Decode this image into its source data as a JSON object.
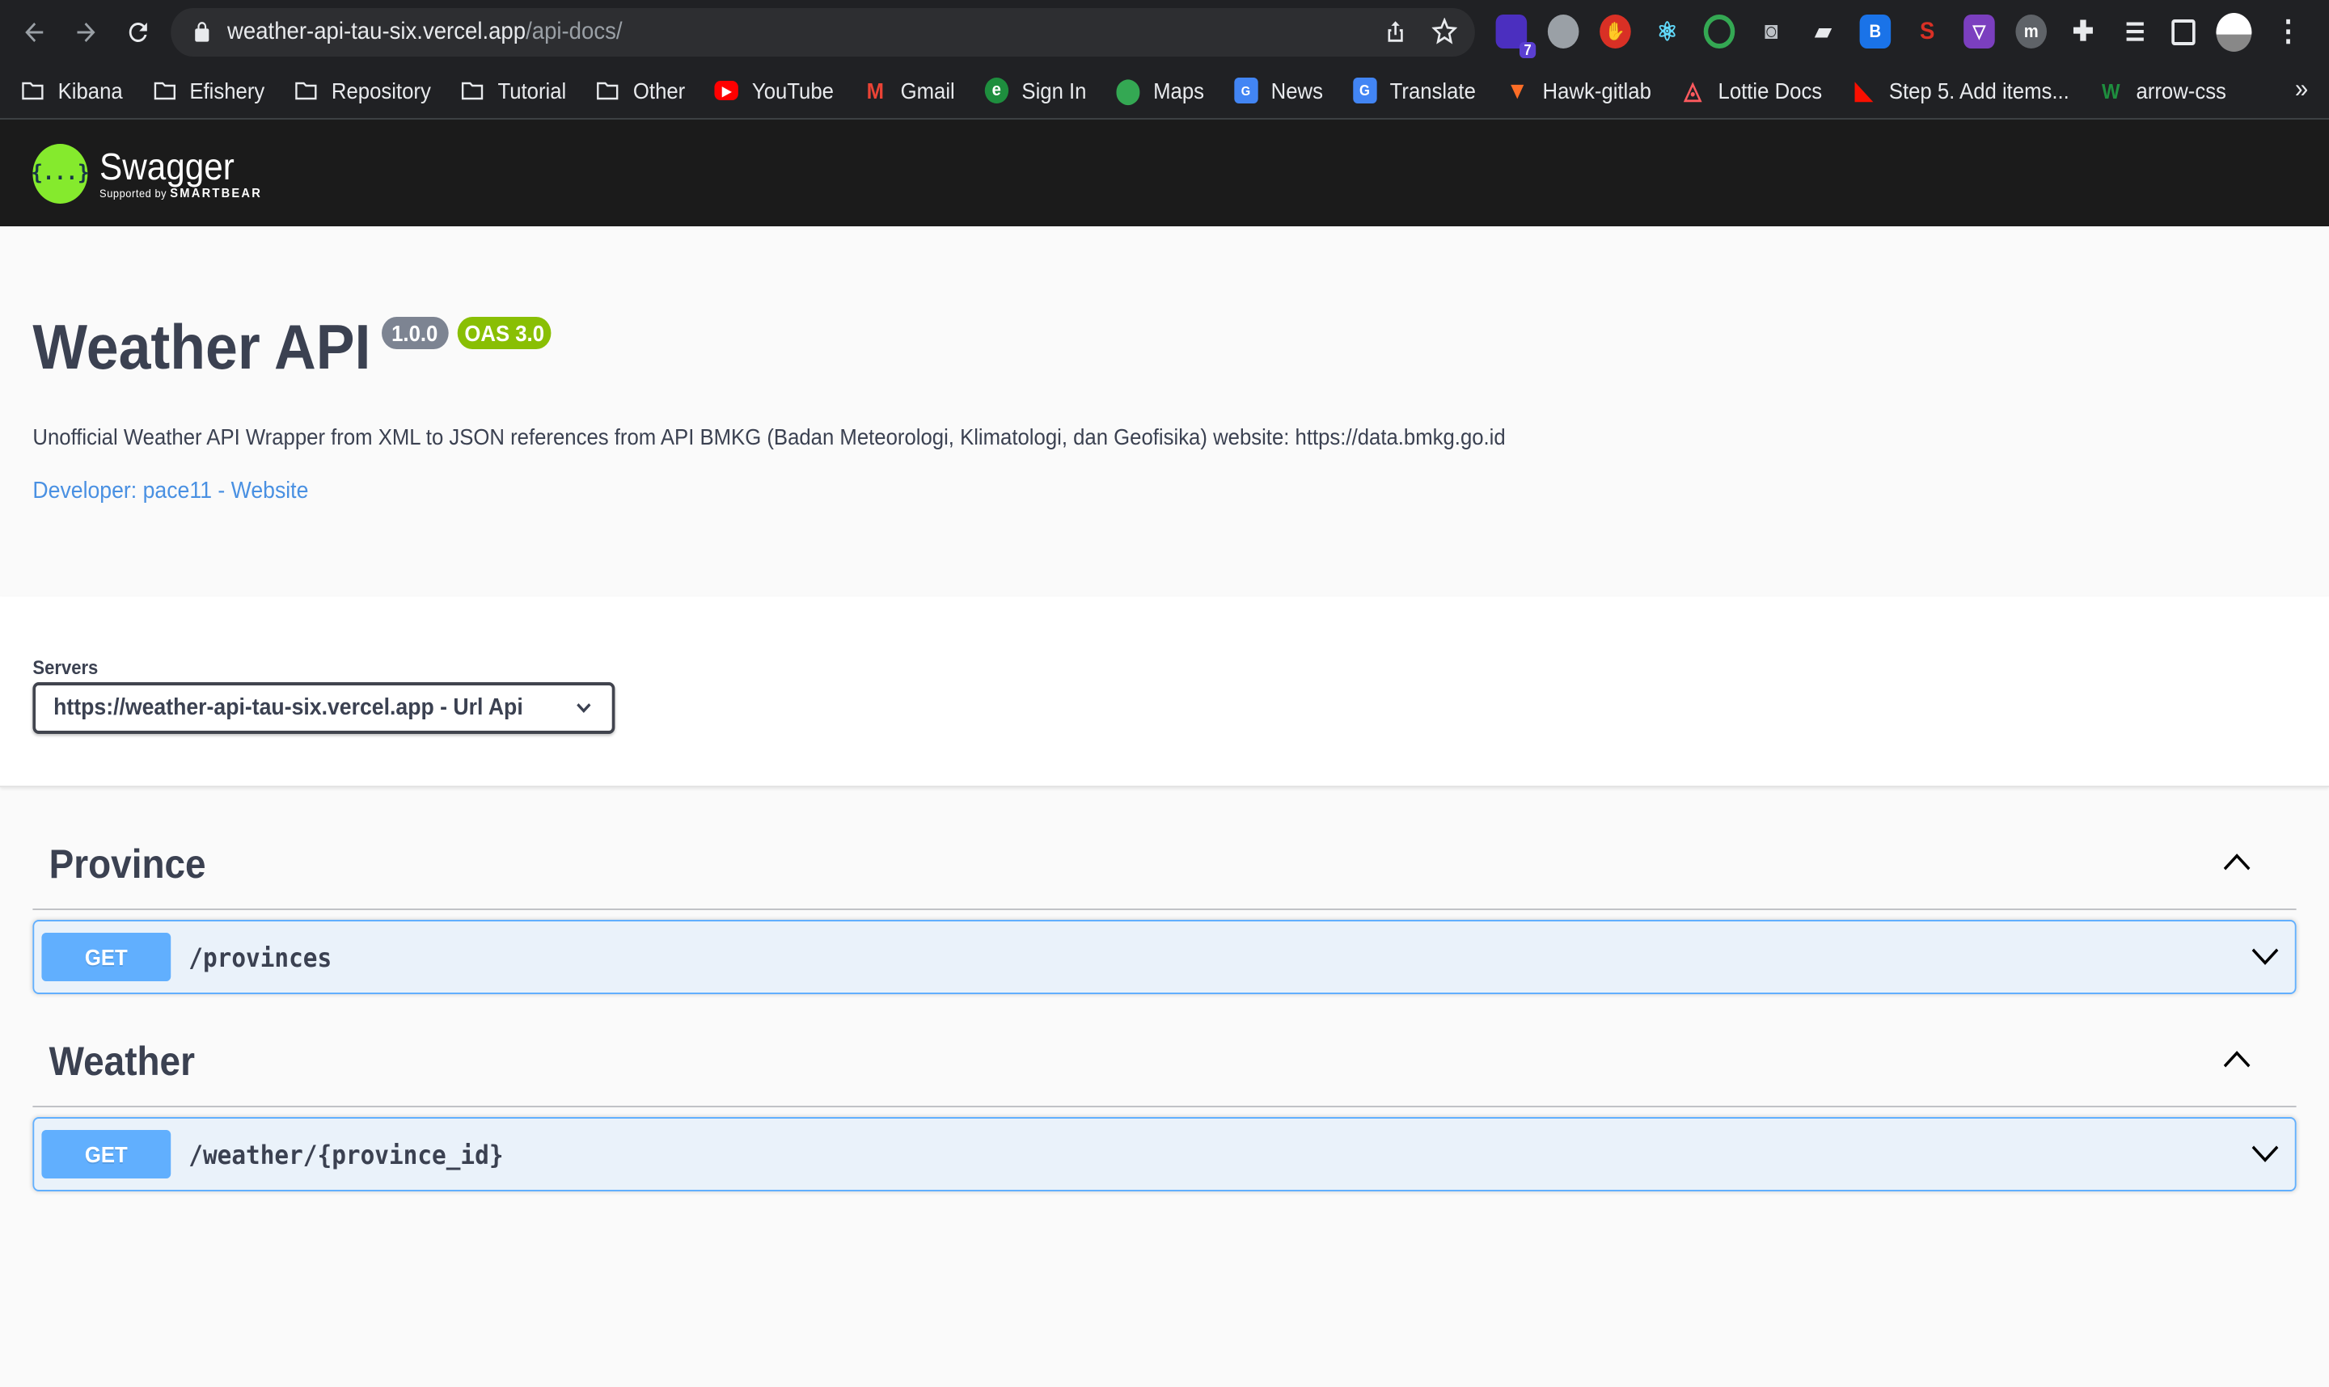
{
  "browser": {
    "url_host": "weather-api-tau-six.vercel.app",
    "url_path": "/api-docs/",
    "extension_badge": "7"
  },
  "bookmarks": [
    {
      "label": "Kibana",
      "icon": "folder-icon"
    },
    {
      "label": "Efishery",
      "icon": "folder-icon"
    },
    {
      "label": "Repository",
      "icon": "folder-icon"
    },
    {
      "label": "Tutorial",
      "icon": "folder-icon"
    },
    {
      "label": "Other",
      "icon": "folder-icon"
    },
    {
      "label": "YouTube",
      "icon": "youtube-icon"
    },
    {
      "label": "Gmail",
      "icon": "gmail-icon"
    },
    {
      "label": "Sign In",
      "icon": "signin-icon"
    },
    {
      "label": "Maps",
      "icon": "maps-icon"
    },
    {
      "label": "News",
      "icon": "news-icon"
    },
    {
      "label": "Translate",
      "icon": "translate-icon"
    },
    {
      "label": "Hawk-gitlab",
      "icon": "gitlab-icon"
    },
    {
      "label": "Lottie Docs",
      "icon": "airbnb-icon"
    },
    {
      "label": "Step 5. Add items...",
      "icon": "adobe-icon"
    },
    {
      "label": "arrow-css",
      "icon": "w-icon"
    }
  ],
  "swagger": {
    "logo_icon": "{...}",
    "logo_text": "Swagger",
    "logo_sub_prefix": "Supported by",
    "logo_sub_brand": "SMARTBEAR"
  },
  "info": {
    "title": "Weather API",
    "version": "1.0.0",
    "oas": "OAS 3.0",
    "description": "Unofficial Weather API Wrapper from XML to JSON references from API BMKG (Badan Meteorologi, Klimatologi, dan Geofisika) website: https://data.bmkg.go.id",
    "developer_link": "Developer: pace11 - Website"
  },
  "servers": {
    "label": "Servers",
    "selected": "https://weather-api-tau-six.vercel.app - Url Api"
  },
  "tags": [
    {
      "name": "Province",
      "operations": [
        {
          "method": "GET",
          "path": "/provinces"
        }
      ]
    },
    {
      "name": "Weather",
      "operations": [
        {
          "method": "GET",
          "path": "/weather/{province_id}"
        }
      ]
    }
  ],
  "colors": {
    "get": "#61affe",
    "swagger_green": "#85ea2d",
    "oas_badge": "#89bf04",
    "version_badge": "#7d8492",
    "link": "#4990e2"
  }
}
